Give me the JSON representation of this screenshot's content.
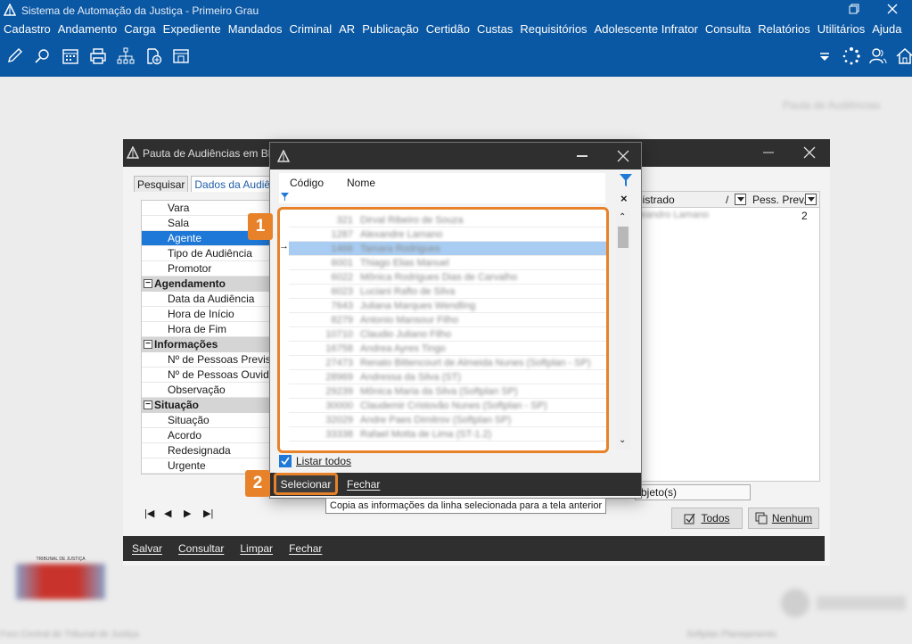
{
  "app": {
    "title": "Sistema de Automação da Justiça - Primeiro Grau"
  },
  "menu": [
    "Cadastro",
    "Andamento",
    "Carga",
    "Expediente",
    "Mandados",
    "Criminal",
    "AR",
    "Publicação",
    "Certidão",
    "Custas",
    "Requisitórios",
    "Adolescente Infrator",
    "Consulta",
    "Relatórios",
    "Utilitários",
    "Ajuda"
  ],
  "main_window": {
    "title": "Pauta de Audiências em Blo",
    "tabs": [
      "Pesquisar",
      "Dados da Audiên"
    ],
    "tree": [
      {
        "type": "item",
        "label": "Vara"
      },
      {
        "type": "item",
        "label": "Sala"
      },
      {
        "type": "item",
        "label": "Agente",
        "selected": true
      },
      {
        "type": "item",
        "label": "Tipo de Audiência"
      },
      {
        "type": "item",
        "label": "Promotor"
      },
      {
        "type": "group",
        "label": "Agendamento"
      },
      {
        "type": "item",
        "label": "Data da Audiência"
      },
      {
        "type": "item",
        "label": "Hora de Início"
      },
      {
        "type": "item",
        "label": "Hora de Fim"
      },
      {
        "type": "group",
        "label": "Informações"
      },
      {
        "type": "item",
        "label": "Nº de Pessoas Prevista"
      },
      {
        "type": "item",
        "label": "Nº de Pessoas Ouvidas"
      },
      {
        "type": "item",
        "label": "Observação"
      },
      {
        "type": "group",
        "label": "Situação"
      },
      {
        "type": "item",
        "label": "Situação"
      },
      {
        "type": "item",
        "label": "Acordo"
      },
      {
        "type": "item",
        "label": "Redesignada"
      },
      {
        "type": "item",
        "label": "Urgente"
      }
    ],
    "grid": {
      "col_registered": "gistrado",
      "col_sep": "/",
      "col_pess": "Pess. Prev.",
      "row_name": "Leandro Lamano",
      "row_pess": "2"
    },
    "objeto_field": "bjeto(s)",
    "btn_todos": "Todos",
    "btn_nenhum": "Nenhum",
    "footer": [
      "Salvar",
      "Consultar",
      "Limpar",
      "Fechar"
    ]
  },
  "popup": {
    "col_code": "Código",
    "col_name": "Nome",
    "rows": [
      {
        "code": "321",
        "name": "Dirval Ribeiro de Souza"
      },
      {
        "code": "1287",
        "name": "Alexandre Lamano"
      },
      {
        "code": "1466",
        "name": "Tamara Rodrigues",
        "selected": true
      },
      {
        "code": "6001",
        "name": "Thiago Elias Manuel"
      },
      {
        "code": "6022",
        "name": "Mônica Rodrigues Dias de Carvalho"
      },
      {
        "code": "6023",
        "name": "Luciani Rafto de Silva"
      },
      {
        "code": "7643",
        "name": "Juliana Marques Wendling"
      },
      {
        "code": "8279",
        "name": "Antonio Mansour Filho"
      },
      {
        "code": "10710",
        "name": "Claudio Juliano Filho"
      },
      {
        "code": "16758",
        "name": "Andrea Ayres Tingo"
      },
      {
        "code": "27473",
        "name": "Renato Bittencourt de Almeida Nunes (Softplan - SP)"
      },
      {
        "code": "28969",
        "name": "Andressa da Silva (ST)"
      },
      {
        "code": "29239",
        "name": "Mônica Maria da Silva (Softplan SP)"
      },
      {
        "code": "30000",
        "name": "Claudemir Cristovão Nunes (Softplan - SP)"
      },
      {
        "code": "32029",
        "name": "Andre Paes Dimitrov (Softplan SP)"
      },
      {
        "code": "33338",
        "name": "Rafael Motta de Lima (ST-1.2)"
      }
    ],
    "listar_todos": "Listar todos",
    "btn_selecionar": "Selecionar",
    "btn_fechar": "Fechar",
    "tooltip": "Copia as informações da linha selecionada para a tela anterior"
  },
  "badges": [
    "1",
    "2"
  ],
  "background": {
    "top_right_text": "Pauta de Audiências",
    "seal_title": "TRIBUNAL DE JUSTIÇA",
    "bottom_left_text": "Foro Central de Tribunal de Justiça",
    "bottom_right_text": "Softplan Planejamento"
  },
  "colors": {
    "titlebar_blue": "#0a57a3",
    "dark_bar": "#2f2f2f",
    "highlight_orange": "#e8822a",
    "selection_blue": "#1e78d8"
  }
}
